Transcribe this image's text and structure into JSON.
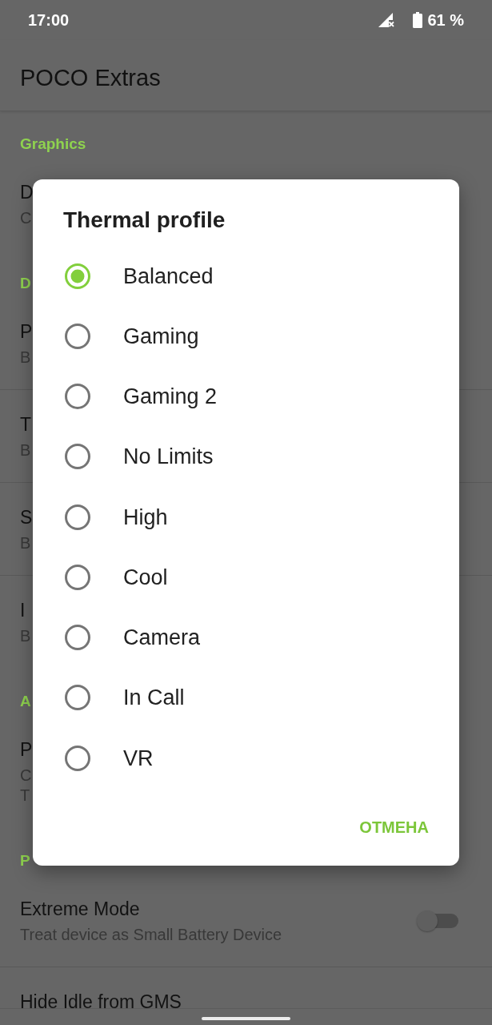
{
  "status_bar": {
    "time": "17:00",
    "battery": "61 %"
  },
  "app_bar": {
    "title": "POCO Extras"
  },
  "sections": [
    {
      "header": "Graphics",
      "items": [
        {
          "kind": "text",
          "title": "D",
          "summary": [
            "C"
          ]
        }
      ]
    },
    {
      "header": "D",
      "items": [
        {
          "kind": "text",
          "title": "P",
          "summary": [
            "B"
          ]
        },
        {
          "kind": "text",
          "title": "T",
          "summary": [
            "B"
          ]
        },
        {
          "kind": "text",
          "title": "S",
          "summary": [
            "B"
          ]
        },
        {
          "kind": "text",
          "title": "I",
          "summary": [
            "B"
          ]
        }
      ]
    },
    {
      "header": "A",
      "items": [
        {
          "kind": "text",
          "title": "P",
          "summary": [
            "C",
            "T"
          ]
        }
      ]
    },
    {
      "header": "P",
      "items": [
        {
          "kind": "switch",
          "title": "Extreme Mode",
          "summary": [
            "Treat device as Small Battery Device"
          ],
          "on": false
        },
        {
          "kind": "text",
          "title": "Hide Idle from GMS"
        }
      ]
    }
  ],
  "dialog": {
    "title": "Thermal profile",
    "options": [
      {
        "label": "Balanced",
        "selected": true
      },
      {
        "label": "Gaming",
        "selected": false
      },
      {
        "label": "Gaming 2",
        "selected": false
      },
      {
        "label": "No Limits",
        "selected": false
      },
      {
        "label": "High",
        "selected": false
      },
      {
        "label": "Cool",
        "selected": false
      },
      {
        "label": "Camera",
        "selected": false
      },
      {
        "label": "In Call",
        "selected": false
      },
      {
        "label": "VR",
        "selected": false
      }
    ],
    "cancel_button": "ОТМЕНА"
  }
}
